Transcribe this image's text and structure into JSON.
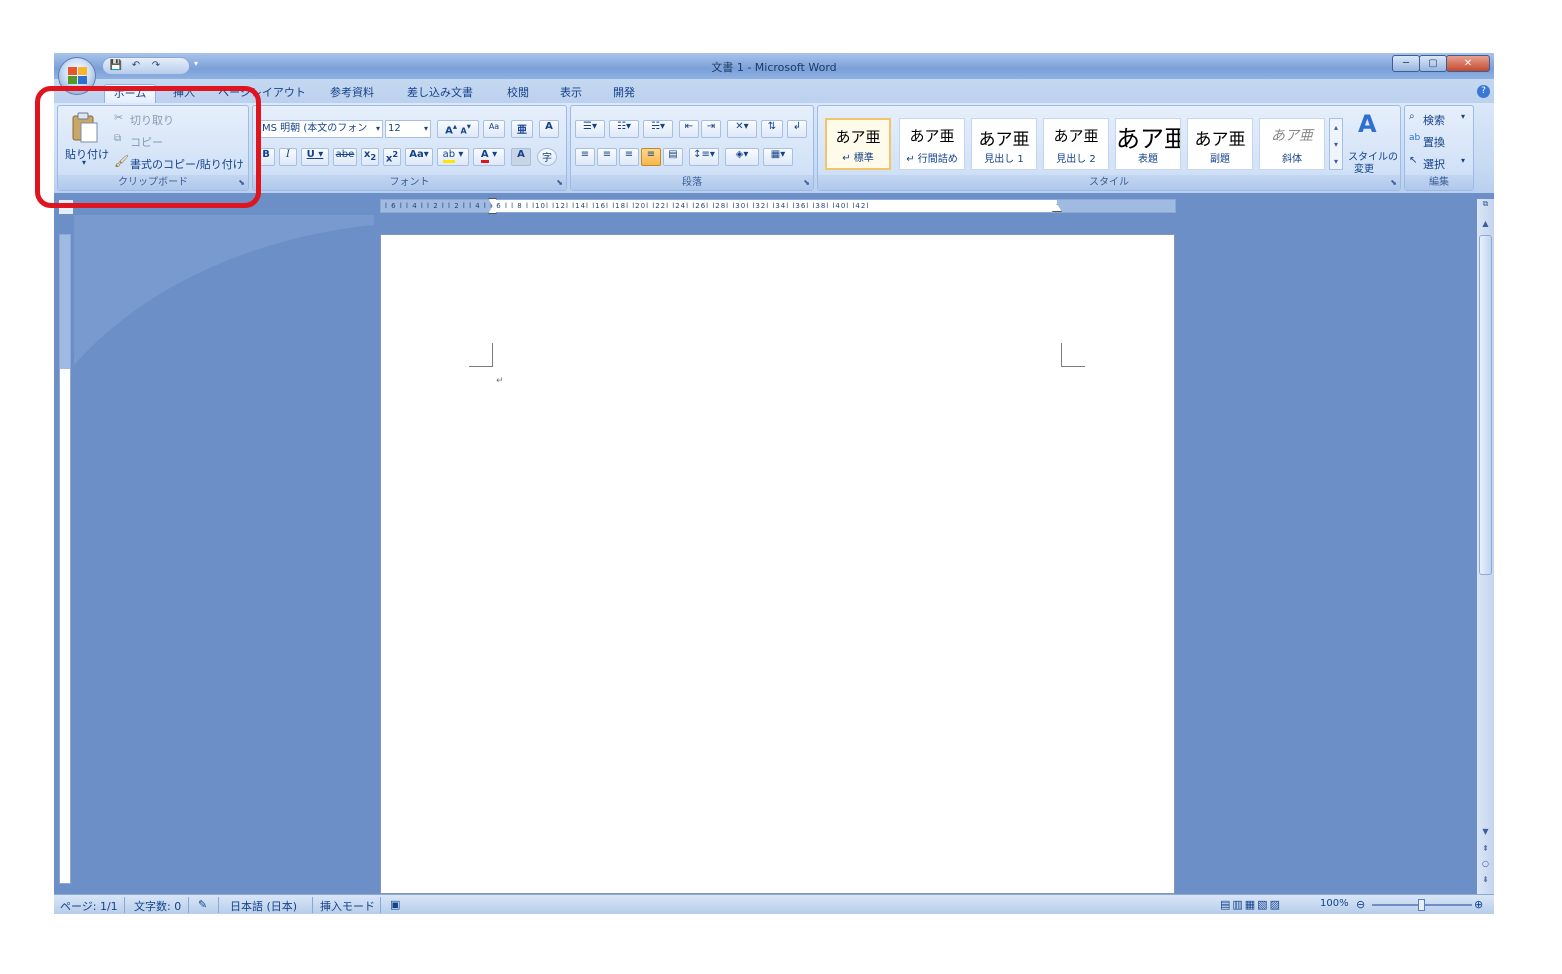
{
  "window": {
    "title": "文書 1 - Microsoft Word",
    "controls": {
      "minimize": "─",
      "maximize": "▢",
      "close": "✕"
    }
  },
  "quick_access": {
    "save": "💾",
    "undo": "↶",
    "redo": "↷",
    "more": "▾"
  },
  "tabs": [
    {
      "label": "ホーム",
      "active": true
    },
    {
      "label": "挿入"
    },
    {
      "label": "ページレイアウト"
    },
    {
      "label": "参考資料"
    },
    {
      "label": "差し込み文書"
    },
    {
      "label": "校閲"
    },
    {
      "label": "表示"
    },
    {
      "label": "開発"
    }
  ],
  "help_label": "?",
  "clipboard": {
    "group_label": "クリップボード",
    "paste_label": "貼り付け",
    "cut_label": "切り取り",
    "copy_label": "コピー",
    "format_painter_label": "書式のコピー/貼り付け"
  },
  "font": {
    "group_label": "フォント",
    "font_name": "MS 明朝 (本文のフォン",
    "font_size": "12",
    "grow": "A",
    "shrink": "A",
    "clear": "Aa",
    "phonetic": "亜",
    "border_char": "A",
    "bold": "B",
    "italic": "I",
    "underline": "U",
    "strike": "abe",
    "subscript": "x",
    "superscript": "x",
    "change_case": "Aa",
    "highlight": "ab",
    "font_color": "A",
    "shading_char": "A",
    "enclose": "字"
  },
  "paragraph": {
    "group_label": "段落"
  },
  "styles": {
    "group_label": "スタイル",
    "items": [
      {
        "preview": "あア亜",
        "label": "↵ 標準"
      },
      {
        "preview": "あア亜",
        "label": "↵ 行間詰め"
      },
      {
        "preview": "あア亜",
        "label": "見出し 1"
      },
      {
        "preview": "あア亜",
        "label": "見出し 2"
      },
      {
        "preview": "あア亜",
        "label": "表題"
      },
      {
        "preview": "あア亜",
        "label": "副題"
      },
      {
        "preview": "あア亜",
        "label": "斜体"
      }
    ],
    "change_styles_label1": "スタイルの",
    "change_styles_label2": "変更"
  },
  "editing": {
    "group_label": "編集",
    "find_label": "検索",
    "replace_label": "置換",
    "select_label": "選択"
  },
  "ruler": {
    "numbers": "l 6 l  l 4 l  l 2 l    l 2 l  l 4 l  l 6 l  l 8 l  l10l  l12l  l14l  l16l  l18l  l20l  l22l  l24l  l26l  l28l  l30l  l32l  l34l  l36l  l38l  l40l  l42l"
  },
  "document": {
    "paragraph_mark": "↵"
  },
  "status": {
    "page": "ページ: 1/1",
    "words": "文字数: 0",
    "language": "日本語 (日本)",
    "mode": "挿入モード",
    "zoom": "100%"
  },
  "colors": {
    "highlight_box": "#e0141e",
    "ribbon": "#d2e2f7",
    "workspace": "#6b8fc6"
  }
}
